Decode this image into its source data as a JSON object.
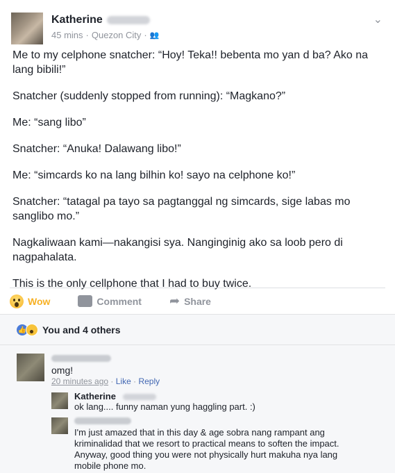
{
  "post": {
    "author": "Katherine",
    "time": "45 mins",
    "location": "Quezon City",
    "separator": "·",
    "paragraphs": [
      "Me to my celphone snatcher: “Hoy! Teka!! bebenta mo yan d ba? Ako na lang bibili!”",
      "Snatcher (suddenly stopped from running): “Magkano?”",
      "Me: “sang libo”",
      "Snatcher: “Anuka! Dalawang libo!”",
      "Me: “simcards ko na lang bilhin ko! sayo na celphone ko!”",
      "Snatcher: “tatagal pa tayo sa pagtanggal ng simcards, sige labas mo sanglibo mo.”",
      "Nagkaliwaan kami—nakangisi sya. Nanginginig ako sa loob pero di nagpahalata.",
      "This is the only cellphone that I had to buy twice."
    ]
  },
  "actions": {
    "wow_label": "Wow",
    "comment_label": "Comment",
    "share_label": "Share"
  },
  "reactions": {
    "summary": "You and 4 others"
  },
  "comments": [
    {
      "text": "omg!",
      "time": "20 minutes ago",
      "like": "Like",
      "reply": "Reply"
    }
  ],
  "replies": [
    {
      "name": "Katherine",
      "text": "ok lang.... funny naman yung haggling part. :)"
    },
    {
      "text": "I'm just amazed that in this day & age sobra nang rampant ang kriminalidad that we resort to practical means to soften the impact. Anyway, good thing you were not physically hurt makuha nya lang mobile phone mo."
    }
  ],
  "icons": {
    "audience": "friends-icon",
    "chevron": "chevron-down-icon",
    "wow": "wow-emoji-icon",
    "comment": "comment-icon",
    "share": "share-icon",
    "like": "like-reaction-icon"
  },
  "colors": {
    "link": "#4267b2",
    "wow": "#f7b125",
    "meta": "#90949c"
  }
}
